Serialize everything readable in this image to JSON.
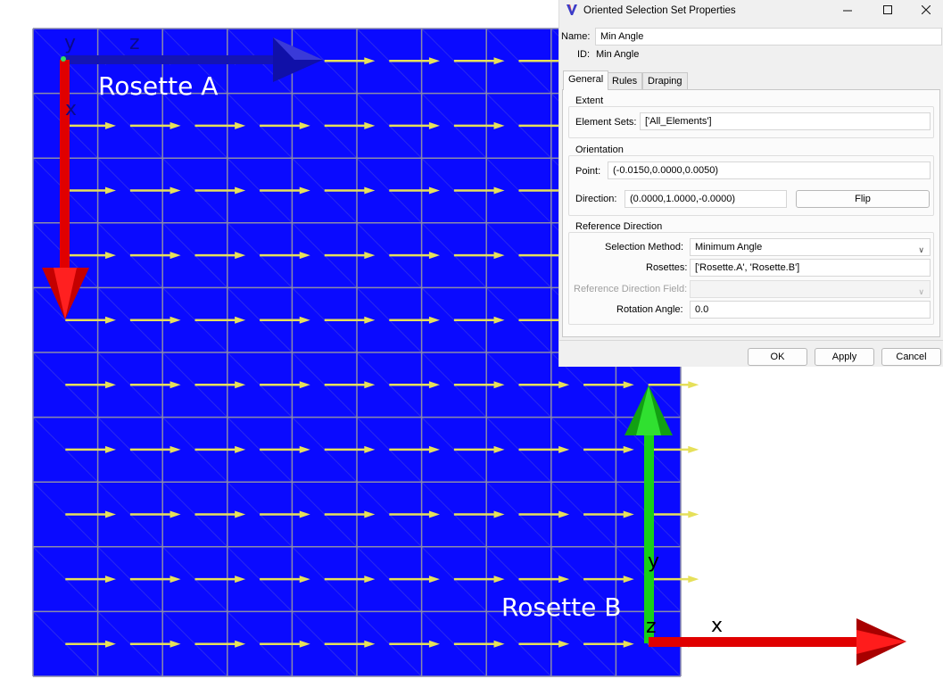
{
  "viewport": {
    "rosette_a_label": "Rosette A",
    "rosette_b_label": "Rosette B",
    "rosette_a_axes": {
      "y": "y",
      "z": "z",
      "x": "x"
    },
    "rosette_b_axes": {
      "y": "y",
      "z": "z",
      "x": "x"
    },
    "colors": {
      "mesh": "#0a0aff",
      "grid": "#8a8aaa",
      "arrow": "#e6e05a",
      "x_axis": "#e00000",
      "y_axis": "#18d018",
      "z_axis": "#1010c0"
    }
  },
  "dialog": {
    "title": "Oriented Selection Set Properties",
    "name_label": "Name:",
    "name_value": "Min Angle",
    "id_label": "ID:",
    "id_value": "Min Angle",
    "tabs": [
      {
        "label": "General",
        "active": true
      },
      {
        "label": "Rules",
        "active": false
      },
      {
        "label": "Draping",
        "active": false
      }
    ],
    "extent": {
      "title": "Extent",
      "element_sets_label": "Element Sets:",
      "element_sets_value": "['All_Elements']"
    },
    "orientation": {
      "title": "Orientation",
      "point_label": "Point:",
      "point_value": "(-0.0150,0.0000,0.0050)",
      "direction_label": "Direction:",
      "direction_value": "(0.0000,1.0000,-0.0000)",
      "flip_label": "Flip"
    },
    "reference_direction": {
      "title": "Reference Direction",
      "selection_method_label": "Selection Method:",
      "selection_method_value": "Minimum Angle",
      "rosettes_label": "Rosettes:",
      "rosettes_value": "['Rosette.A', 'Rosette.B']",
      "ref_field_label": "Reference Direction Field:",
      "ref_field_value": "",
      "rotation_angle_label": "Rotation Angle:",
      "rotation_angle_value": "0.0"
    },
    "buttons": {
      "ok": "OK",
      "apply": "Apply",
      "cancel": "Cancel"
    }
  }
}
